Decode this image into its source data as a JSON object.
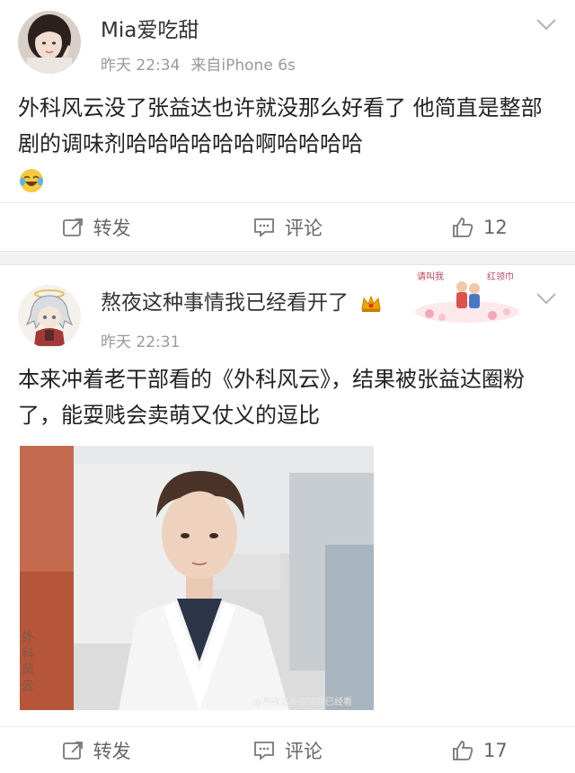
{
  "posts": [
    {
      "username": "Mia爱吃甜",
      "time": "昨天 22:34",
      "source": "来自iPhone 6s",
      "text": "外科风云没了张益达也许就没那么好看了 他简直是整部剧的调味剂哈哈哈哈哈哈啊哈哈哈哈",
      "emoji": "laughing-crying-emoji",
      "actions": {
        "repost": "转发",
        "comment": "评论",
        "like_count": "12"
      }
    },
    {
      "username": "熬夜这种事情我已经看开了",
      "time": "昨天 22:31",
      "text": "本来冲着老干部看的《外科风云》，结果被张益达圈粉了，能耍贱会卖萌又仗义的逗比",
      "decoration": {
        "label1": "请叫我",
        "label2": "红领巾"
      },
      "image": {
        "side_text": "外科风云",
        "watermark": "@熬夜这种事情我已经看"
      },
      "actions": {
        "repost": "转发",
        "comment": "评论",
        "like_count": "17"
      }
    }
  ],
  "colors": {
    "text": "#222222",
    "meta": "#999999",
    "action": "#666666",
    "separator": "#f2f2f2",
    "vip": "#f0a500"
  }
}
